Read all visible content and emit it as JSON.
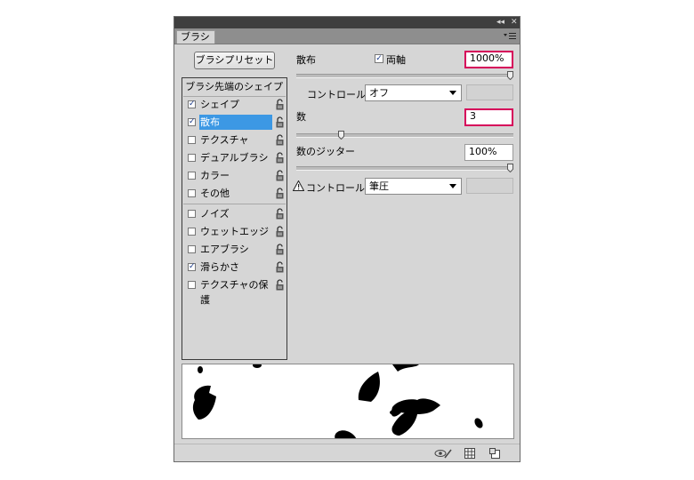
{
  "panel": {
    "title_bar": {
      "collapse_icon": "double-chevron-left-icon",
      "close_icon": "close-icon"
    },
    "tab_label": "ブラシ",
    "menu_icon": "panel-menu-icon",
    "preset_button_label": "ブラシプリセット",
    "list": {
      "header": "ブラシ先端のシェイプ",
      "items": [
        {
          "label": "シェイプ",
          "checked": true
        },
        {
          "label": "散布",
          "checked": true,
          "selected": true
        },
        {
          "label": "テクスチャ",
          "checked": false
        },
        {
          "label": "デュアルブラシ",
          "checked": false
        },
        {
          "label": "カラー",
          "checked": false
        },
        {
          "label": "その他",
          "checked": false
        },
        {
          "label": "ノイズ",
          "checked": false
        },
        {
          "label": "ウェットエッジ",
          "checked": false
        },
        {
          "label": "エアブラシ",
          "checked": false
        },
        {
          "label": "滑らかさ",
          "checked": true
        },
        {
          "label": "テクスチャの保護",
          "checked": false
        }
      ],
      "checkmark": "✓"
    },
    "scatter": {
      "label": "散布",
      "both_axes_label": "両軸",
      "both_axes_checked": true,
      "value": "1000%",
      "slider_fraction": 1.0,
      "control_label": "コントロール：",
      "control_value": "オフ"
    },
    "count": {
      "label": "数",
      "value": "3",
      "slider_fraction": 0.2
    },
    "count_jitter": {
      "label": "数のジッター",
      "value": "100%",
      "slider_fraction": 1.0,
      "control_label": "コントロール：",
      "control_value": "筆圧",
      "warning_icon": "warning-icon"
    },
    "bottom_icons": [
      "eye-brush-icon",
      "grid-icon",
      "new-preset-icon"
    ]
  }
}
